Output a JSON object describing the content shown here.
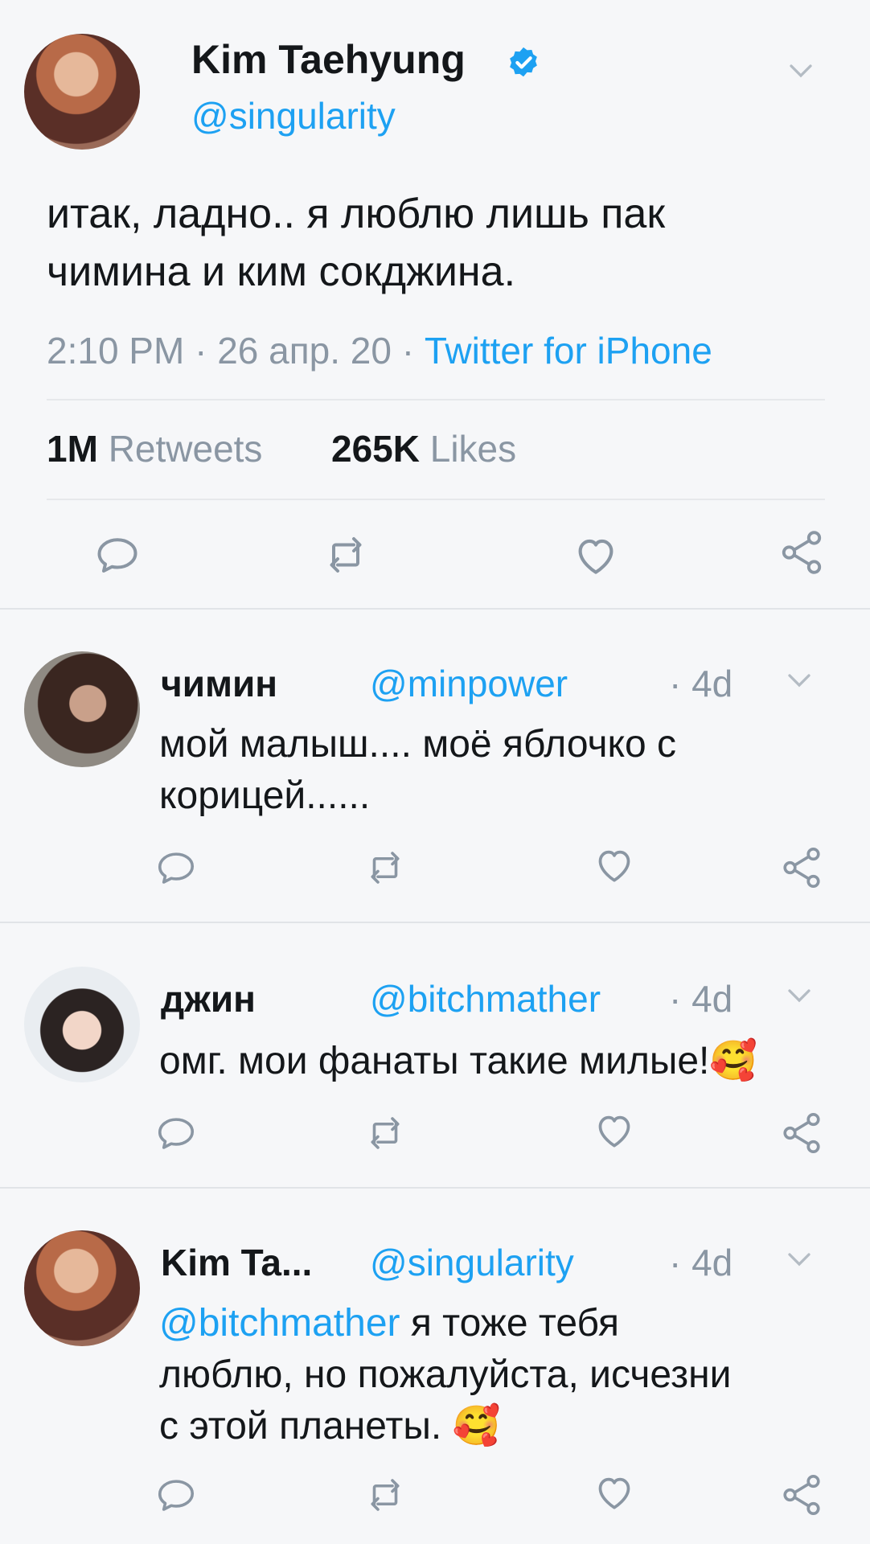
{
  "main_tweet": {
    "name": "Kim Taehyung",
    "handle": "@singularity",
    "text_line1": "итак, ладно.. я люблю лишь пак",
    "text_line2": "чимина и ким сокджина.",
    "time": "2:10 PM",
    "sep1": "·",
    "date": "26 апр. 20",
    "sep2": "·",
    "source": "Twitter for iPhone",
    "retweets_count": "1M",
    "retweets_label": "Retweets",
    "likes_count": "265K",
    "likes_label": "Likes"
  },
  "replies": [
    {
      "name": "чимин",
      "handle": "@minpower",
      "age": "· 4d",
      "line1": "мой малыш.... моё яблочко с",
      "line2": "корицей......"
    },
    {
      "name": "джин",
      "handle": "@bitchmather",
      "age": "· 4d",
      "line1": "омг. мои фанаты такие милые!",
      "emoji": "🥰"
    },
    {
      "name": "Kim Ta...",
      "handle": "@singularity",
      "age": "· 4d",
      "mention": "@bitchmather",
      "line1_rest": " я тоже тебя",
      "line2": "люблю, но пожалуйста, исчезни",
      "line3": "с этой планеты. ",
      "emoji": "🥰"
    }
  ],
  "colors": {
    "accent": "#1da1f2",
    "background": "#f6f7f9",
    "muted": "#8a96a3"
  },
  "icons": [
    "verified-badge-icon",
    "chevron-down-icon",
    "reply-icon",
    "retweet-icon",
    "like-icon",
    "share-icon"
  ]
}
